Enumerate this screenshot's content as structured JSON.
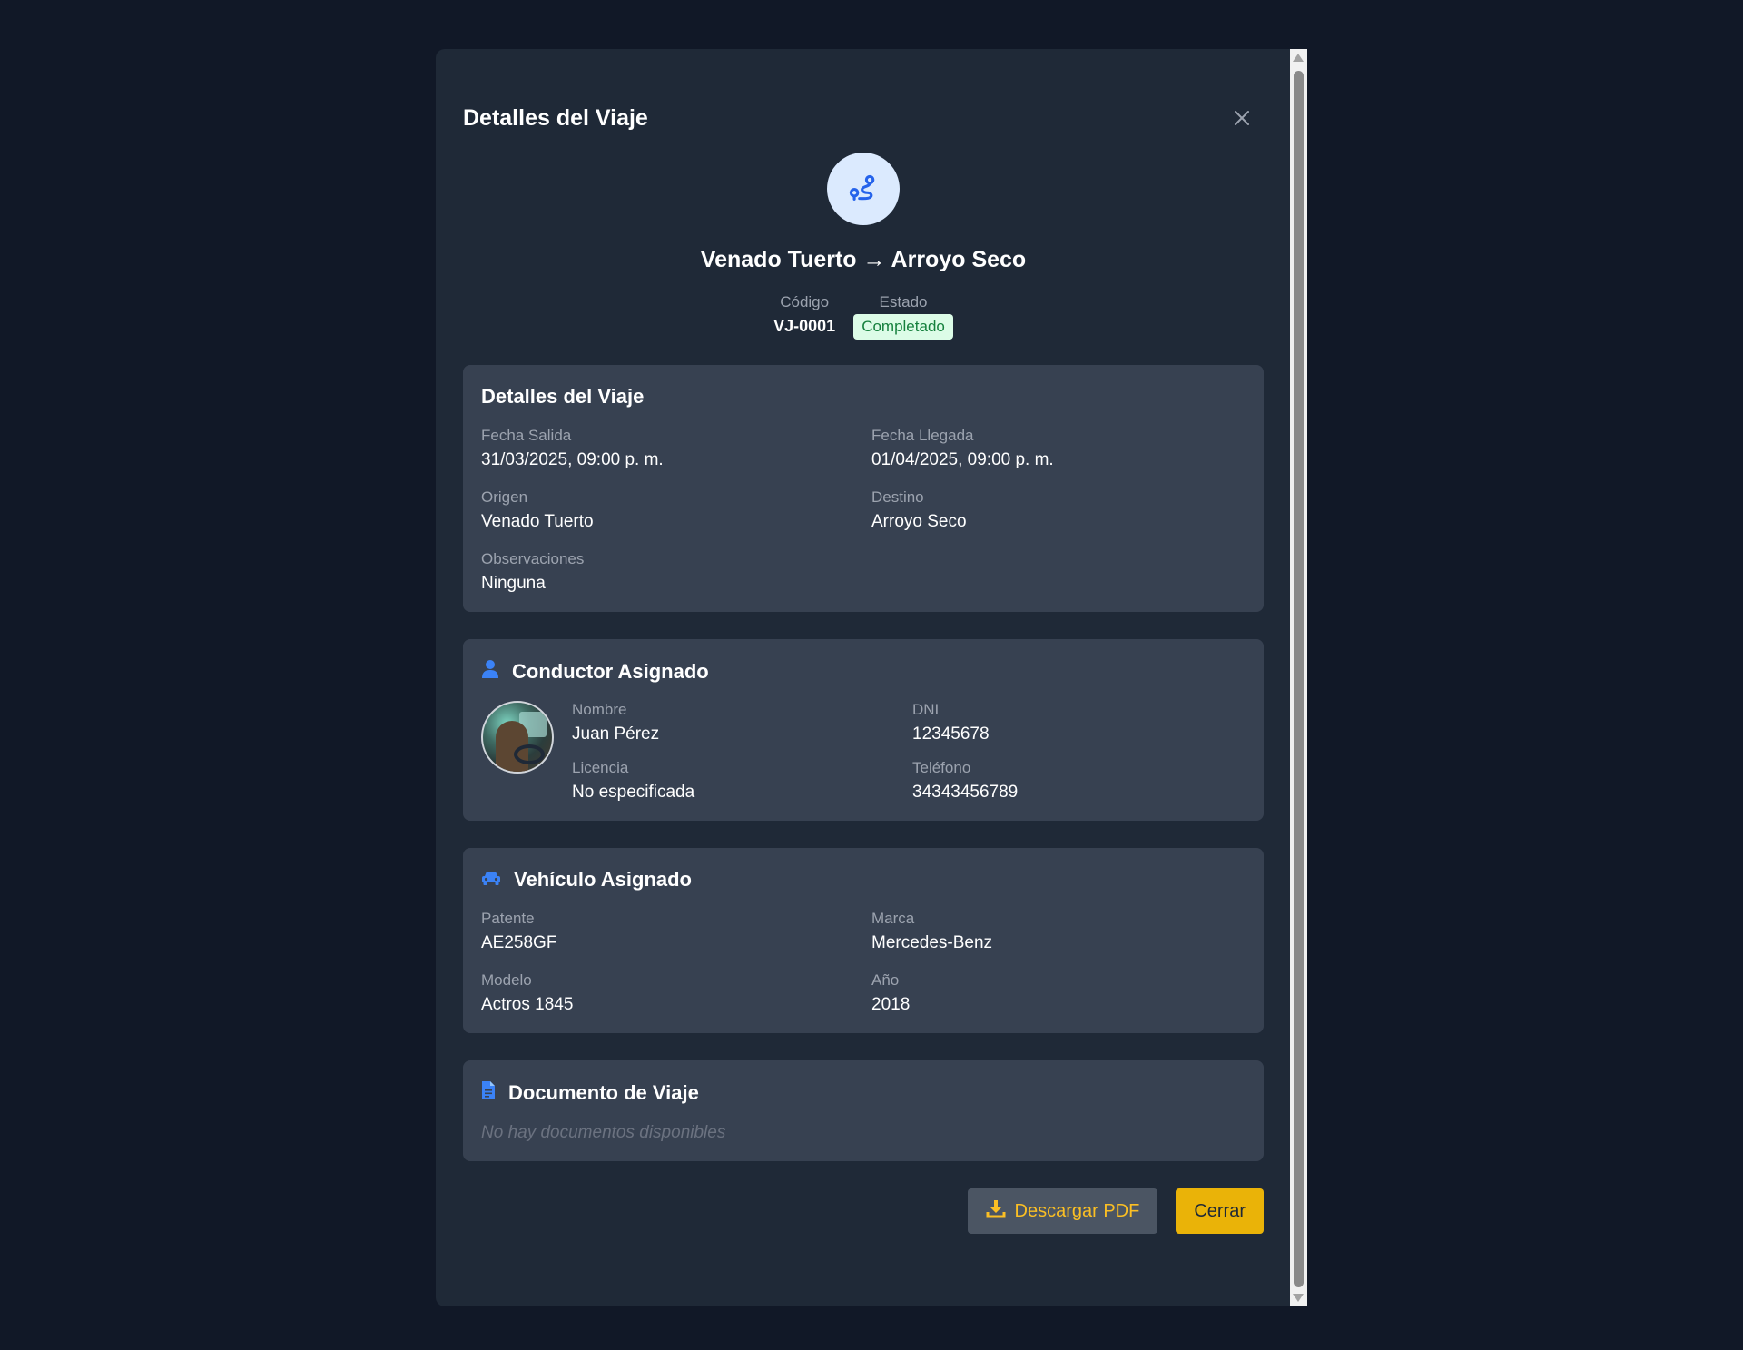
{
  "modal": {
    "title": "Detalles del Viaje",
    "close_icon": "close-icon"
  },
  "trip": {
    "icon": "route-icon",
    "route_title": "Venado Tuerto → Arroyo Seco",
    "code_label": "Código",
    "code_value": "VJ-0001",
    "status_label": "Estado",
    "status_value": "Completado",
    "status_color": "#15803d"
  },
  "details": {
    "title": "Detalles del Viaje",
    "fields": [
      {
        "label": "Fecha Salida",
        "value": "31/03/2025, 09:00 p. m."
      },
      {
        "label": "Fecha Llegada",
        "value": "01/04/2025, 09:00 p. m."
      },
      {
        "label": "Origen",
        "value": "Venado Tuerto"
      },
      {
        "label": "Destino",
        "value": "Arroyo Seco"
      },
      {
        "label": "Observaciones",
        "value": "Ninguna"
      }
    ]
  },
  "driver": {
    "title": "Conductor Asignado",
    "icon": "user-icon",
    "fields": [
      {
        "label": "Nombre",
        "value": "Juan Pérez"
      },
      {
        "label": "DNI",
        "value": "12345678"
      },
      {
        "label": "Licencia",
        "value": "No especificada"
      },
      {
        "label": "Teléfono",
        "value": "34343456789"
      }
    ]
  },
  "vehicle": {
    "title": "Vehículo Asignado",
    "icon": "car-icon",
    "fields": [
      {
        "label": "Patente",
        "value": "AE258GF"
      },
      {
        "label": "Marca",
        "value": "Mercedes-Benz"
      },
      {
        "label": "Modelo",
        "value": "Actros 1845"
      },
      {
        "label": "Año",
        "value": "2018"
      }
    ]
  },
  "document": {
    "title": "Documento de Viaje",
    "icon": "document-icon",
    "empty_text": "No hay documentos disponibles"
  },
  "footer": {
    "download_label": "Descargar PDF",
    "download_icon": "download-icon",
    "close_label": "Cerrar"
  },
  "colors": {
    "accent_blue": "#3b82f6",
    "accent_yellow": "#eab308",
    "background": "#111827",
    "card": "#374151"
  }
}
